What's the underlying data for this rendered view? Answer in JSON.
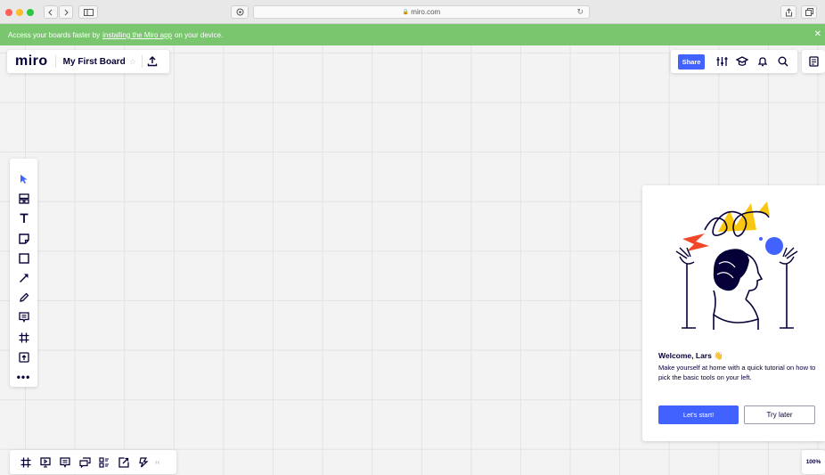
{
  "browser": {
    "address": "miro.com",
    "address_prefix": "🔒",
    "back_icon": "chevron-left-icon",
    "forward_icon": "chevron-right-icon"
  },
  "banner": {
    "text_before": "Access your boards faster by",
    "link": "installing the Miro app",
    "text_after": "on your device.",
    "close": "✕",
    "color": "#79c66f"
  },
  "header": {
    "logo": "miro",
    "board_title": "My First Board",
    "star": "☆",
    "share_label": "Share"
  },
  "toolbar": {
    "more": "•••",
    "tools": [
      "select-icon",
      "templates-icon",
      "text-icon",
      "sticky-note-icon",
      "shape-icon",
      "connection-line-icon",
      "pen-icon",
      "comment-icon",
      "frame-icon",
      "upload-icon"
    ]
  },
  "bottom_bar": {
    "collapse": "‹‹",
    "zoom": "100%"
  },
  "welcome": {
    "title": "Welcome, Lars 👋",
    "body": "Make yourself at home with a quick tutorial on how to pick the basic tools on your left.",
    "start_label": "Let's start!",
    "later_label": "Try later"
  },
  "colors": {
    "accent": "#4262ff",
    "text": "#050038",
    "yellow": "#fac710",
    "red": "#f24726"
  }
}
